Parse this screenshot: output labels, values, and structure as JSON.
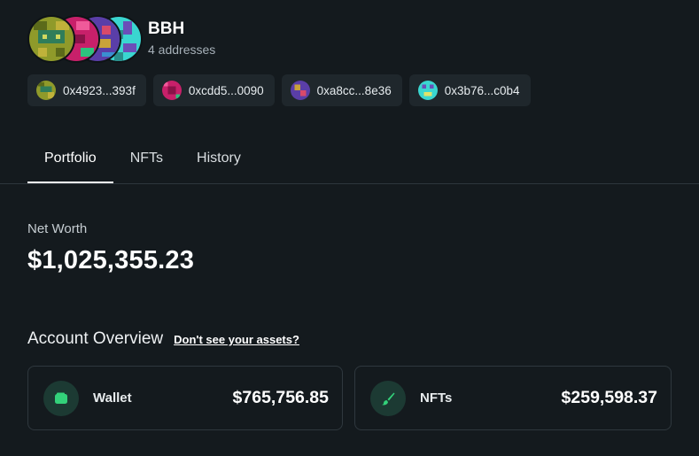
{
  "wallet": {
    "name": "BBH",
    "address_count": "4 addresses"
  },
  "addresses": [
    {
      "short": "0x4923...393f",
      "avatar": "pixel-avatar-olive"
    },
    {
      "short": "0xcdd5...0090",
      "avatar": "pixel-avatar-pink"
    },
    {
      "short": "0xa8cc...8e36",
      "avatar": "pixel-avatar-purple"
    },
    {
      "short": "0x3b76...c0b4",
      "avatar": "pixel-avatar-teal"
    }
  ],
  "tabs": [
    {
      "label": "Portfolio",
      "active": true
    },
    {
      "label": "NFTs",
      "active": false
    },
    {
      "label": "History",
      "active": false
    }
  ],
  "net_worth": {
    "label": "Net Worth",
    "value": "$1,025,355.23"
  },
  "account_overview": {
    "title": "Account Overview",
    "help_link": "Don't see your assets?",
    "cards": [
      {
        "label": "Wallet",
        "value": "$765,756.85",
        "icon": "wallet-icon"
      },
      {
        "label": "NFTs",
        "value": "$259,598.37",
        "icon": "brush-icon"
      }
    ]
  },
  "colors": {
    "background": "#141a1e",
    "chip": "#1f272c",
    "accent_green": "#33d17a",
    "icon_circle": "#1c3a33"
  }
}
